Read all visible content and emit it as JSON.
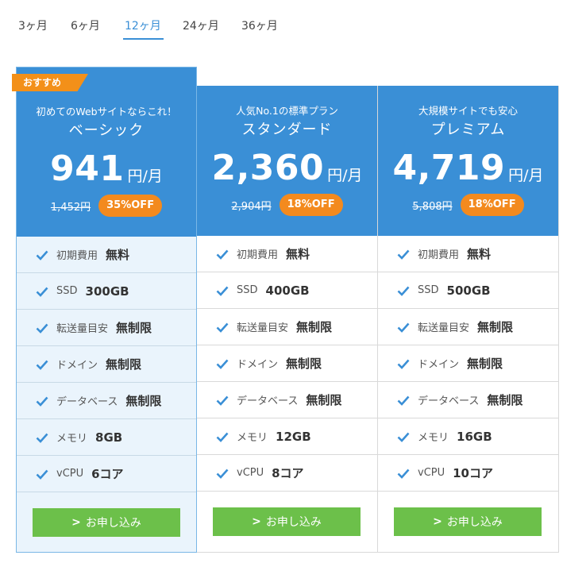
{
  "tabs": [
    {
      "label": "3ヶ月",
      "active": false
    },
    {
      "label": "6ヶ月",
      "active": false
    },
    {
      "label": "12ヶ月",
      "active": true
    },
    {
      "label": "24ヶ月",
      "active": false
    },
    {
      "label": "36ヶ月",
      "active": false
    }
  ],
  "colors": {
    "accent": "#3a8fd6",
    "badge": "#f39019",
    "discount": "#f38a1e",
    "apply_button": "#6cc04a",
    "recommended_bg": "#eaf4fc"
  },
  "icons": {
    "feature": "check-icon",
    "apply": "chevron-right-icon"
  },
  "plans": [
    {
      "badge": "おすすめ",
      "tagline": "初めてのWebサイトならこれ！",
      "name": "ベーシック",
      "price": "941",
      "unit": "円/月",
      "old_price": "1,452円",
      "discount": "35%OFF",
      "features": [
        {
          "label": "初期費用",
          "value": "無料"
        },
        {
          "label": "SSD",
          "value": "300GB"
        },
        {
          "label": "転送量目安",
          "value": "無制限"
        },
        {
          "label": "ドメイン",
          "value": "無制限"
        },
        {
          "label": "データベース",
          "value": "無制限"
        },
        {
          "label": "メモリ",
          "value": "8GB"
        },
        {
          "label": "vCPU",
          "value": "6コア"
        }
      ],
      "apply_label": "お申し込み"
    },
    {
      "tagline": "人気No.1の標準プラン",
      "name": "スタンダード",
      "price": "2,360",
      "unit": "円/月",
      "old_price": "2,904円",
      "discount": "18%OFF",
      "features": [
        {
          "label": "初期費用",
          "value": "無料"
        },
        {
          "label": "SSD",
          "value": "400GB"
        },
        {
          "label": "転送量目安",
          "value": "無制限"
        },
        {
          "label": "ドメイン",
          "value": "無制限"
        },
        {
          "label": "データベース",
          "value": "無制限"
        },
        {
          "label": "メモリ",
          "value": "12GB"
        },
        {
          "label": "vCPU",
          "value": "8コア"
        }
      ],
      "apply_label": "お申し込み"
    },
    {
      "tagline": "大規模サイトでも安心",
      "name": "プレミアム",
      "price": "4,719",
      "unit": "円/月",
      "old_price": "5,808円",
      "discount": "18%OFF",
      "features": [
        {
          "label": "初期費用",
          "value": "無料"
        },
        {
          "label": "SSD",
          "value": "500GB"
        },
        {
          "label": "転送量目安",
          "value": "無制限"
        },
        {
          "label": "ドメイン",
          "value": "無制限"
        },
        {
          "label": "データベース",
          "value": "無制限"
        },
        {
          "label": "メモリ",
          "value": "16GB"
        },
        {
          "label": "vCPU",
          "value": "10コア"
        }
      ],
      "apply_label": "お申し込み"
    }
  ]
}
